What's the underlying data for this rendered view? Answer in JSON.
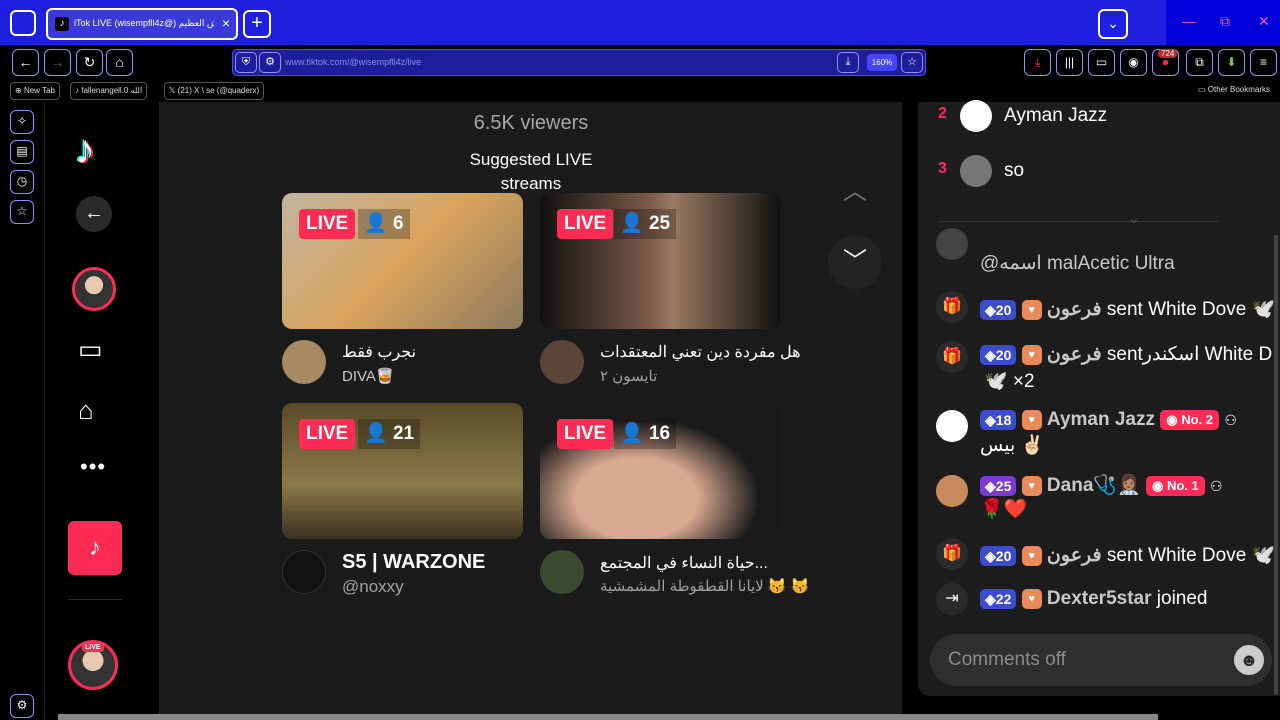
{
  "browser": {
    "tab_title": "iTok LIVE (wisempfll4z@) قلبوش العظيم",
    "tab_favicon": "♪",
    "url": "www.tiktok.com/@wisempfll4z/live",
    "zoom": "160%",
    "badge_count": "724",
    "bookmarks": [
      "New Tab",
      "fallenangell.0 الله",
      "(21) X \\ se (@quaderx)"
    ],
    "other_bookmarks": "Other Bookmarks"
  },
  "live": {
    "viewers": "6.5K viewers",
    "suggested_title": "Suggested LIVE streams",
    "live_label": "LIVE",
    "streams": [
      {
        "count": "6",
        "title": "نجرب فقط",
        "sub": "DIVA🥃"
      },
      {
        "count": "25",
        "title": "هل مفردة دين تعني المعتقدات",
        "sub": "تايسون ٢"
      },
      {
        "count": "21",
        "title": "S5 | WARZONE",
        "sub": "@noxxy"
      },
      {
        "count": "16",
        "title": "حياة النساء في المجتمع...",
        "sub": "لايانا القطقوطة المشمشية 😽 😽"
      }
    ]
  },
  "ranking": [
    {
      "rank": "2",
      "name": "Ayman Jazz"
    },
    {
      "rank": "3",
      "name": "so"
    }
  ],
  "chat": [
    {
      "type": "text",
      "text": "@اسمه malAcetic Ultra"
    },
    {
      "type": "gift",
      "level": "20",
      "name": "فرعون",
      "text": "sent White Dove 🕊️"
    },
    {
      "type": "gift",
      "level": "20",
      "name": "فرعون",
      "text": "sentاسكندر  White D",
      "extra": "🕊️ ×2"
    },
    {
      "type": "comment",
      "level": "18",
      "name": "Ayman Jazz",
      "badge": "No. 2",
      "text": "بيس ✌🏻"
    },
    {
      "type": "comment",
      "level": "25",
      "name": "Dana🩺👩🏽‍⚕️",
      "badge": "No. 1",
      "text": "🌹❤️"
    },
    {
      "type": "gift",
      "level": "20",
      "name": "فرعون",
      "text": "sent White Dove 🕊️"
    },
    {
      "type": "join",
      "level": "22",
      "name": "Dexter5star",
      "text": "joined"
    }
  ],
  "comment_placeholder": "Comments off",
  "colors": {
    "accent": "#fe2c55",
    "level_blue": "#3c4ccf",
    "level_purple": "#7b3ad6"
  }
}
